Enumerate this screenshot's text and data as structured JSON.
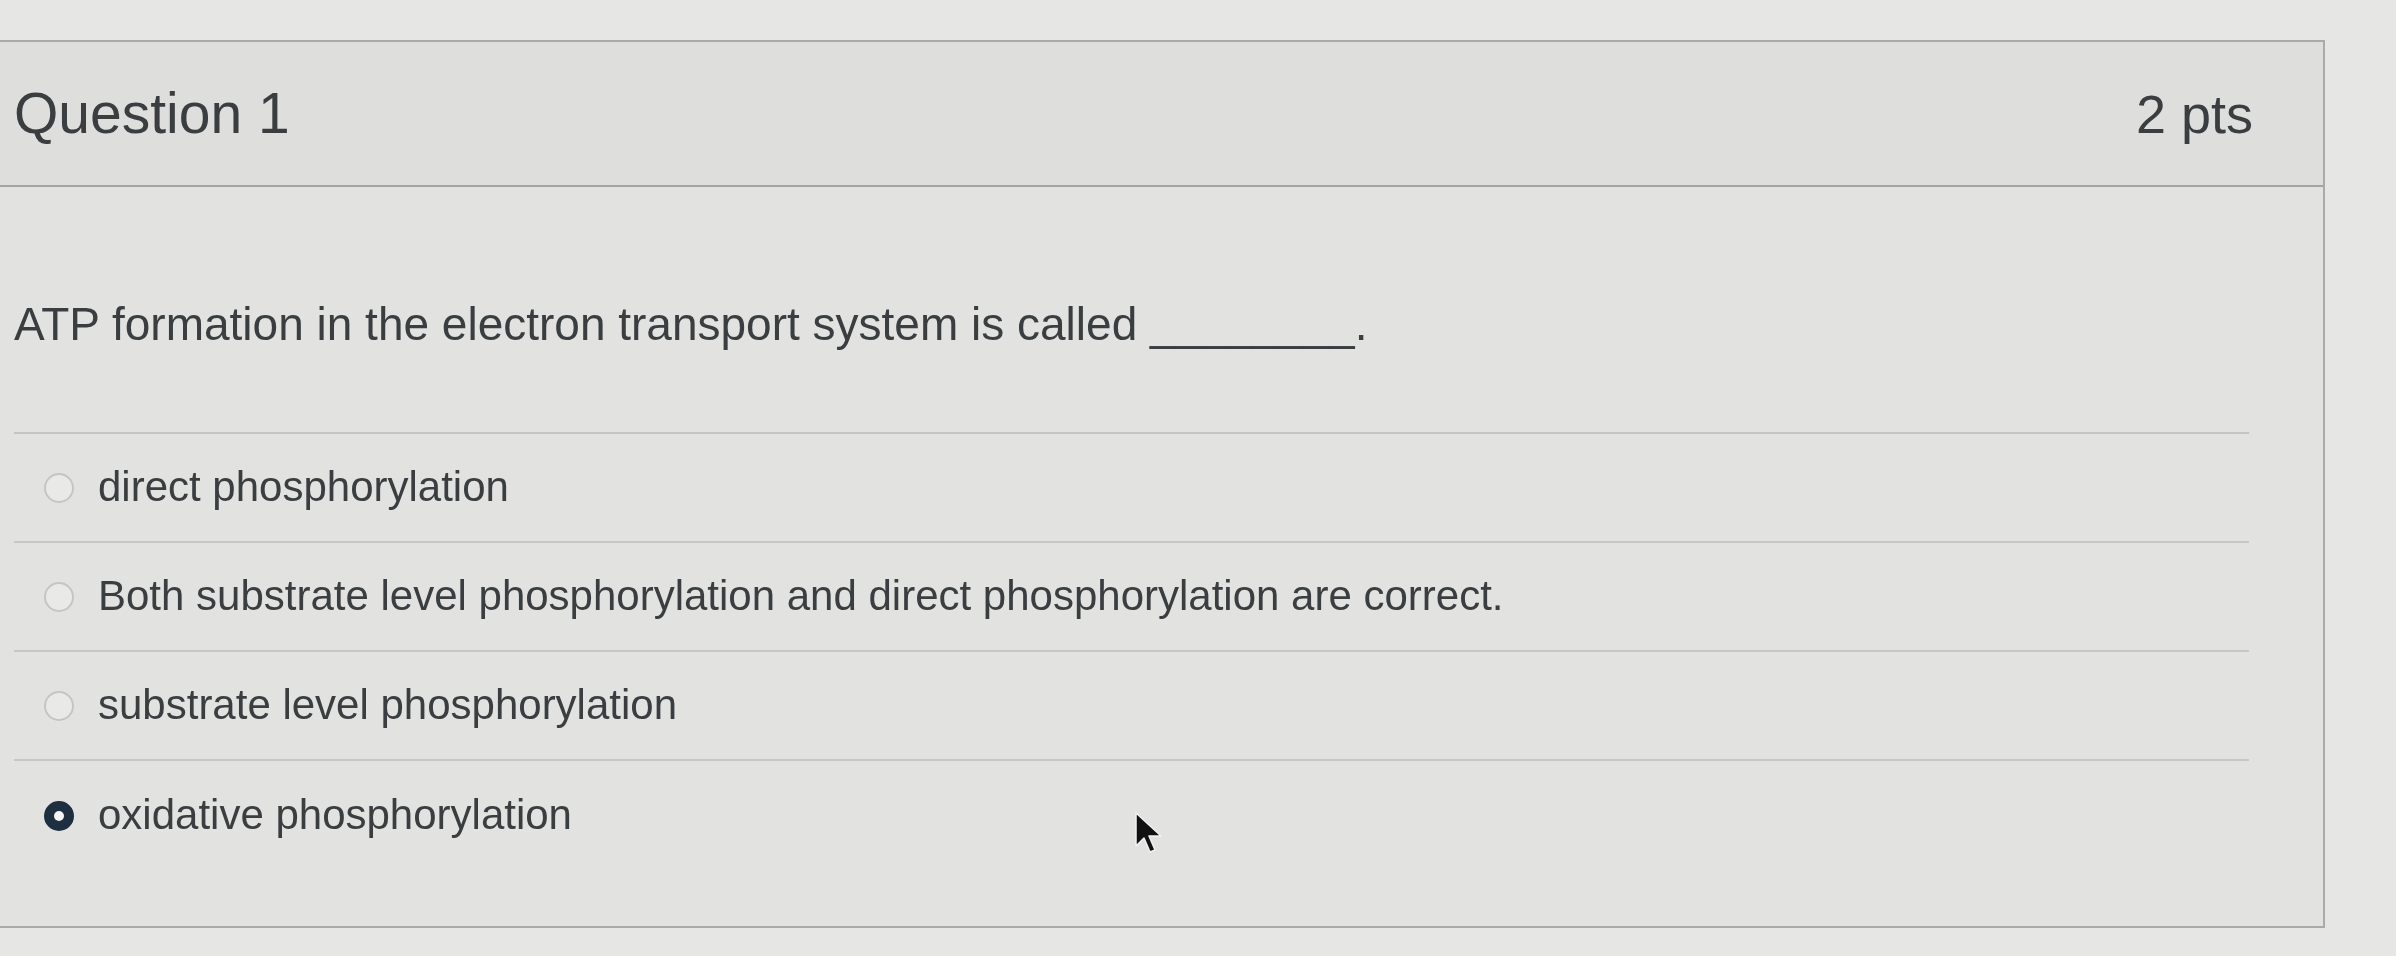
{
  "question": {
    "title": "Question 1",
    "points": "2 pts",
    "text": "ATP formation in the electron transport system is called ________."
  },
  "answers": [
    {
      "label": "direct phosphorylation",
      "selected": false
    },
    {
      "label": "Both substrate level phosphorylation and direct phosphorylation are correct.",
      "selected": false
    },
    {
      "label": "substrate level phosphorylation",
      "selected": false
    },
    {
      "label": "oxidative phosphorylation",
      "selected": true
    }
  ]
}
